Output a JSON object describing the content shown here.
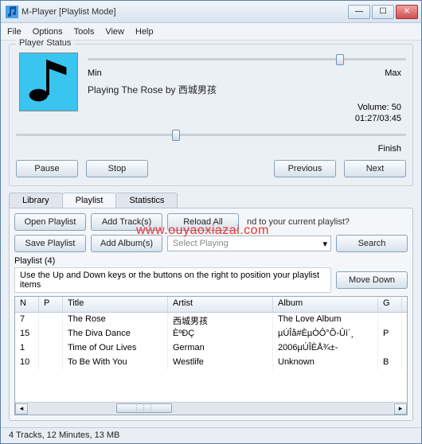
{
  "window": {
    "title": "M-Player [Playlist Mode]"
  },
  "menu": {
    "file": "File",
    "options": "Options",
    "tools": "Tools",
    "view": "View",
    "help": "Help"
  },
  "status": {
    "legend": "Player Status",
    "min": "Min",
    "max": "Max",
    "now_playing": "Playing The Rose by 西城男孩",
    "volume": "Volume: 50",
    "time": "01:27/03:45",
    "finish": "Finish"
  },
  "buttons": {
    "pause": "Pause",
    "stop": "Stop",
    "previous": "Previous",
    "next": "Next",
    "open_playlist": "Open Playlist",
    "add_tracks": "Add Track(s)",
    "reload_all": "Reload All",
    "save_playlist": "Save Playlist",
    "add_albums": "Add Album(s)",
    "search": "Search",
    "move_down": "Move Down"
  },
  "tabs": {
    "library": "Library",
    "playlist": "Playlist",
    "statistics": "Statistics"
  },
  "playlist_panel": {
    "note": "nd to your current playlist?",
    "select_placeholder": "Select Playing",
    "sublegend": "Playlist (4)",
    "hint": "Use the Up and Down keys or the buttons on the right to position your playlist items"
  },
  "grid": {
    "headers": {
      "n": "N",
      "p": "P",
      "title": "Title",
      "artist": "Artist",
      "album": "Album",
      "g": "G"
    },
    "rows": [
      {
        "n": "7",
        "p": "",
        "title": "The Rose",
        "artist": "西城男孩",
        "album": "The Love Album",
        "g": ""
      },
      {
        "n": "15",
        "p": "",
        "title": "The Diva Dance",
        "artist": "ÈºÐÇ",
        "album": "µÚÎå#ÈµÒÔ°Õ-Ûì´¸",
        "g": "P"
      },
      {
        "n": "1",
        "p": "",
        "title": "Time of Our Lives",
        "artist": "German",
        "album": "2006µÚÎÈÅ¾±-",
        "g": ""
      },
      {
        "n": "10",
        "p": "",
        "title": "To Be With You",
        "artist": "Westlife",
        "album": "Unknown",
        "g": "B"
      }
    ]
  },
  "statusbar": "4 Tracks, 12 Minutes, 13 MB",
  "watermark": "www.ouyaoxiazai.com"
}
